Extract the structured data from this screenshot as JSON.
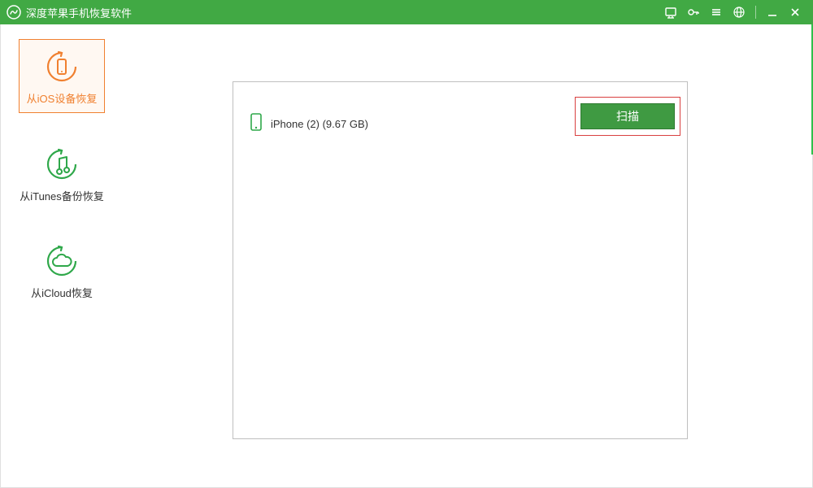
{
  "titlebar": {
    "title": "深度苹果手机恢复软件"
  },
  "sidebar": {
    "items": [
      {
        "label": "从iOS设备恢复",
        "icon": "phone-restore-icon",
        "active": true
      },
      {
        "label": "从iTunes备份恢复",
        "icon": "music-restore-icon",
        "active": false
      },
      {
        "label": "从iCloud恢复",
        "icon": "cloud-restore-icon",
        "active": false
      }
    ]
  },
  "main": {
    "device": {
      "name": "iPhone (2) (9.67 GB)"
    },
    "scan_button": "扫描"
  },
  "colors": {
    "brand_green": "#41a944",
    "accent_orange": "#f08030",
    "scan_button_bg": "#3f9a42",
    "highlight_border": "#d94040"
  }
}
